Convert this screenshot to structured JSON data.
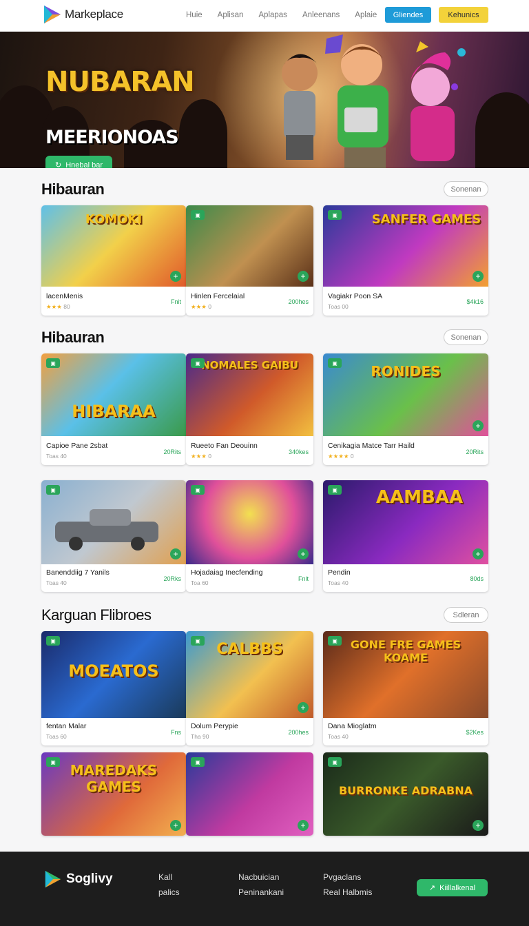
{
  "header": {
    "brand": "Markeplace",
    "nav": [
      "Huie",
      "Aplisan",
      "Aplapas",
      "Anleenans",
      "Aplaie"
    ],
    "btn_primary": "Gliendes",
    "btn_secondary": "Kehunics"
  },
  "hero": {
    "title": "NUBARAN",
    "subtitle": "MEERIONOAS",
    "cta": "Hnebal bar"
  },
  "sections": [
    {
      "title": "Hibauran",
      "see_all": "Sonenan",
      "cards": [
        {
          "name": "lacenMenis",
          "meta": "★★★ 80",
          "price": "Fnit",
          "art": "KOMOKI"
        },
        {
          "name": "Hinlen Fercelaial",
          "meta": "★★★ 0",
          "price": "200hes",
          "art": ""
        },
        {
          "name": "Vagiakr Poon SA",
          "meta": "Toas 00",
          "price": "$4k16",
          "art": "SANFER GAMES"
        }
      ]
    },
    {
      "title": "Hibauran",
      "see_all": "Sonenan",
      "cards": [
        {
          "name": "Capioe Pane 2sbat",
          "meta": "Toas 40",
          "price": "20Rits",
          "art": "HIBARAA"
        },
        {
          "name": "Rueeto Fan Deouinn",
          "meta": "★★★ 0",
          "price": "340kes",
          "art": "NOMALES GAIBU"
        },
        {
          "name": "Cenikagia Matce Tarr Haild",
          "meta": "★★★★ 0",
          "price": "20Rits",
          "art": "RONIDES"
        },
        {
          "name": "Banenddiig 7 Yanils",
          "meta": "Toas 40",
          "price": "20Rks",
          "art": ""
        },
        {
          "name": "Hojadaiag Inecfending",
          "meta": "Toa 60",
          "price": "Fnit",
          "art": ""
        },
        {
          "name": "Pendin",
          "meta": "Toas 40",
          "price": "80ds",
          "art": "AAMBAA"
        }
      ]
    },
    {
      "title": "Karguan Flibroes",
      "see_all": "Sdleran",
      "cards": [
        {
          "name": "fentan Malar",
          "meta": "Toas 60",
          "price": "Fns",
          "art": "MOEATOS"
        },
        {
          "name": "Dolum Perypie",
          "meta": "Tha 90",
          "price": "200hes",
          "art": "CALBBS"
        },
        {
          "name": "Dana Mioglatm",
          "meta": "Toas 40",
          "price": "$2Kes",
          "art": "GONE FRE GAMES KOAME"
        },
        {
          "name": "",
          "meta": "",
          "price": "",
          "art": "MAREDAKS GAMES"
        },
        {
          "name": "",
          "meta": "",
          "price": "",
          "art": ""
        },
        {
          "name": "",
          "meta": "",
          "price": "",
          "art": "BURRONKE ADRABNA"
        }
      ]
    }
  ],
  "footer": {
    "brand": "Soglivy",
    "col1": [
      "Kall",
      "palics"
    ],
    "col2": [
      "Nacbuician",
      "Peninankani"
    ],
    "col3": [
      "Pvgaclans",
      "Real Halbmis"
    ],
    "cta": "Kiillalkenal"
  },
  "colors": {
    "accent_green": "#2fb86a",
    "accent_blue": "#1e9bd8",
    "accent_yellow": "#f3d23a",
    "footer_bg": "#1d1d1d"
  }
}
